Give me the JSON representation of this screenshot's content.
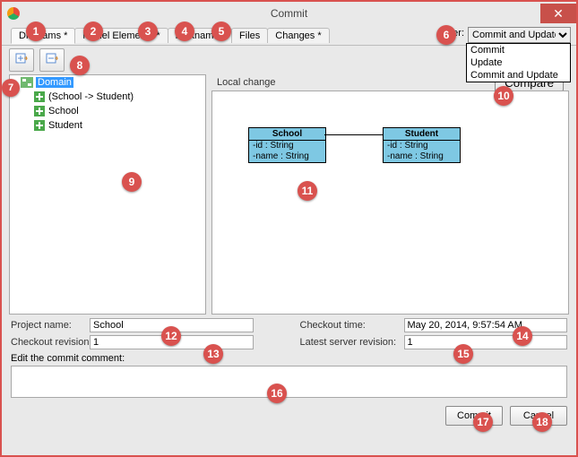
{
  "window": {
    "title": "Commit"
  },
  "tabs": [
    {
      "label": "Diagrams *"
    },
    {
      "label": "Model Elements *"
    },
    {
      "label": "Nicknames"
    },
    {
      "label": "Files"
    },
    {
      "label": "Changes *"
    }
  ],
  "filter": {
    "label": "Filter:",
    "selected": "Commit and Update",
    "options": [
      "Commit",
      "Update",
      "Commit and Update"
    ]
  },
  "tree": {
    "root": {
      "label": "Domain",
      "children": [
        {
          "label": "(School -> Student)"
        },
        {
          "label": "School"
        },
        {
          "label": "Student"
        }
      ]
    }
  },
  "preview": {
    "title": "Local change",
    "compare_label": "Compare",
    "entities": [
      {
        "name": "School",
        "attrs": [
          "-id : String",
          "-name : String"
        ]
      },
      {
        "name": "Student",
        "attrs": [
          "-id : String",
          "-name : String"
        ]
      }
    ]
  },
  "form": {
    "project_name": {
      "label": "Project name:",
      "value": "School"
    },
    "checkout_rev": {
      "label": "Checkout revision:",
      "value": "1"
    },
    "checkout_time": {
      "label": "Checkout time:",
      "value": "May 20, 2014, 9:57:54 AM"
    },
    "server_rev": {
      "label": "Latest server revision:",
      "value": "1"
    },
    "comment_label": "Edit the commit comment:"
  },
  "buttons": {
    "commit": "Commit",
    "cancel": "Cancel"
  },
  "callouts": [
    1,
    2,
    3,
    4,
    5,
    6,
    7,
    8,
    9,
    10,
    11,
    12,
    13,
    14,
    15,
    16,
    17,
    18
  ]
}
